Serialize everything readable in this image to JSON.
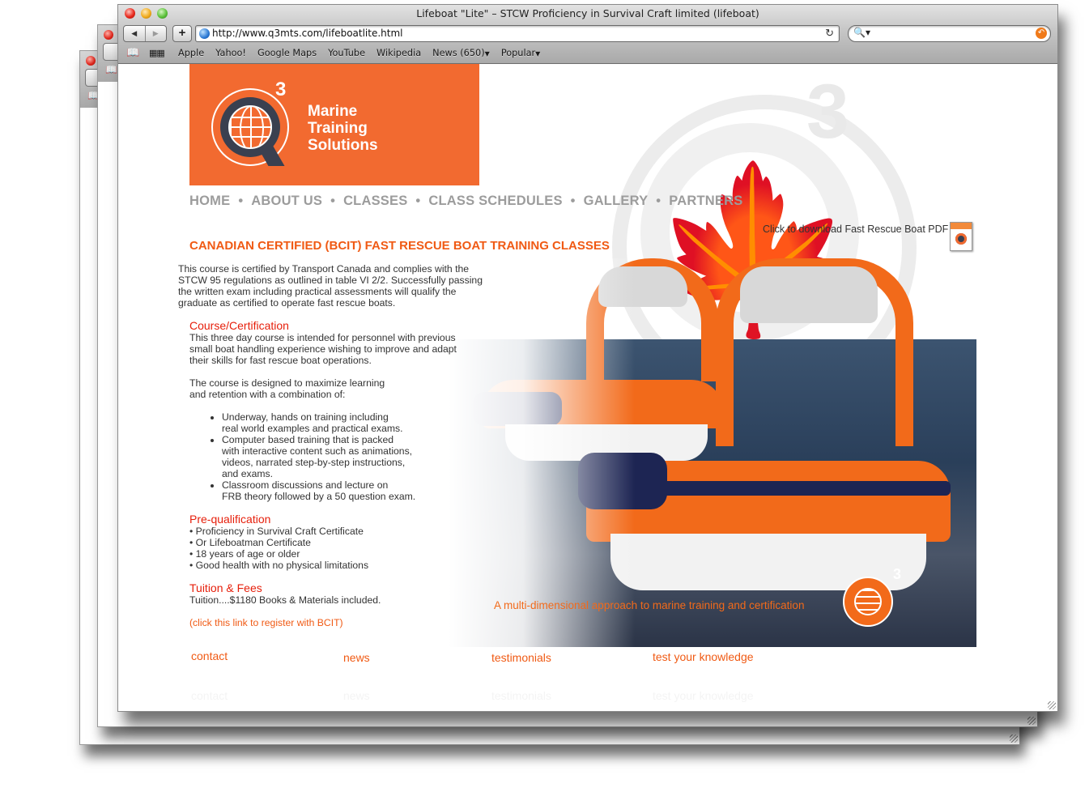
{
  "browser": {
    "window_title": "Lifeboat \"Lite\" – STCW Proficiency in Survival Craft limited (lifeboat)",
    "url": "http://www.q3mts.com/lifeboatlite.html",
    "search_placeholder": "",
    "bookmarks": [
      "Apple",
      "Yahoo!",
      "Google Maps",
      "YouTube",
      "Wikipedia",
      "News (650)",
      "Popular"
    ],
    "bookmark_dropdowns": {
      "News (650)": true,
      "Popular": true
    }
  },
  "brand": {
    "logo_superscript": "3",
    "logo_lines": [
      "Marine",
      "Training",
      "Solutions"
    ],
    "accent_color": "#f26a30",
    "dark_color": "#3a4050"
  },
  "nav": {
    "items": [
      "HOME",
      "ABOUT US",
      "CLASSES",
      "CLASS SCHEDULES",
      "GALLERY",
      "PARTNERS"
    ],
    "separator": "•"
  },
  "pdf": {
    "label": "Click to download Fast Rescue Boat PDF"
  },
  "main": {
    "title": "CANADIAN CERTIFIED (BCIT) FAST RESCUE BOAT TRAINING CLASSES",
    "intro": [
      "This course is certified by Transport Canada and complies with the",
      "STCW 95 regulations as outlined in table VI 2/2. Successfully passing",
      "the written exam including practical assessments will qualify the",
      "graduate as certified to operate fast rescue boats."
    ],
    "course_heading": "Course/Certification",
    "course_text": [
      "This three day course is intended for personnel with previous",
      "small boat handling experience wishing to improve and adapt",
      "their skills for fast rescue boat operations."
    ],
    "course_text2": [
      "The course is designed to maximize learning",
      "and retention with a combination of:"
    ],
    "bullets": [
      [
        "Underway, hands on training including",
        "real world examples and practical exams."
      ],
      [
        "Computer based training that is packed",
        "with interactive content such as animations,",
        "videos, narrated step-by-step instructions,",
        "and exams."
      ],
      [
        "Classroom discussions and lecture on",
        "FRB theory followed by a 50 question exam."
      ]
    ],
    "prequal_heading": "Pre-qualification",
    "prequal_items": [
      "• Proficiency in Survival Craft Certificate",
      "• Or Lifeboatman Certificate",
      "• 18 years of age or older",
      "• Good health with no physical limitations"
    ],
    "tuition_heading": "Tuition & Fees",
    "tuition_text": "Tuition....$1180 Books & Materials included.",
    "register_link": "(click this link to register with BCIT)"
  },
  "hero": {
    "tagline": "A multi-dimensional approach to marine training and certification",
    "logo_superscript": "3"
  },
  "footer": {
    "links": [
      "contact",
      "news",
      "testimonials",
      "test your knowledge"
    ]
  }
}
